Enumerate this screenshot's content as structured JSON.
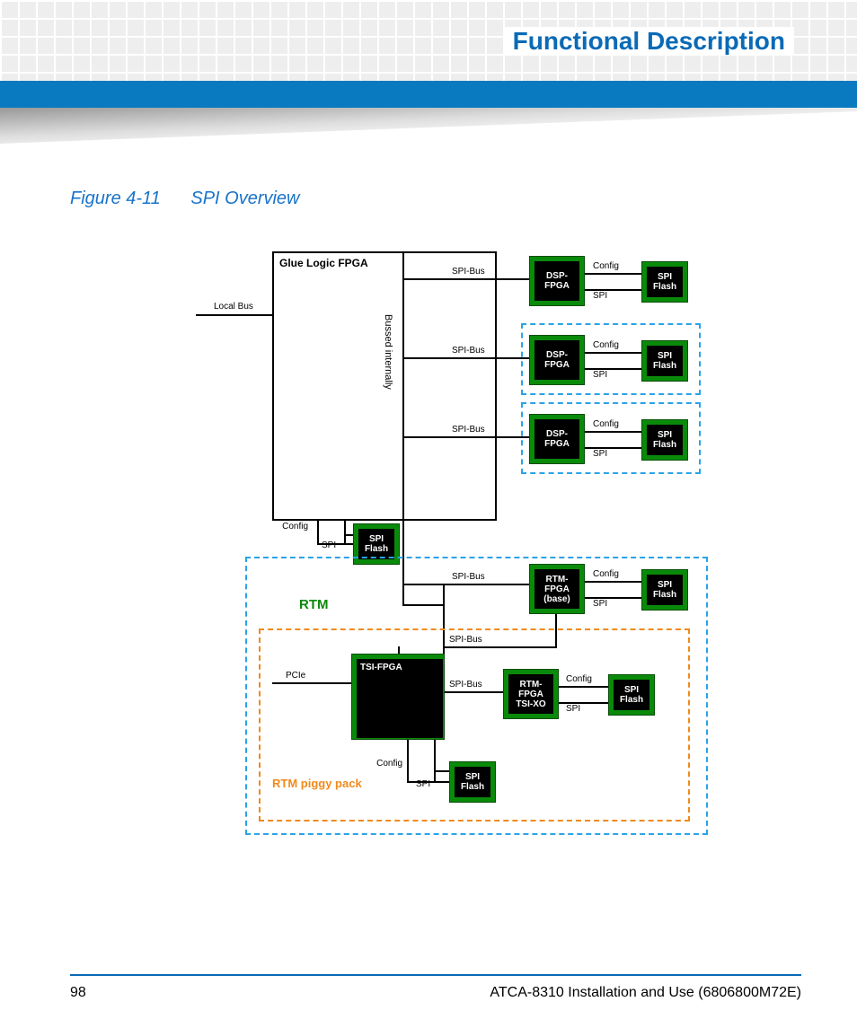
{
  "header": {
    "title": "Functional Description"
  },
  "figure": {
    "caption_num": "Figure 4-11",
    "caption_title": "SPI Overview",
    "glue_label": "Glue Logic FPGA",
    "bussed": "Bussed internally",
    "rtm": "RTM",
    "piggy": "RTM piggy pack",
    "labels": {
      "local_bus": "Local Bus",
      "spi_bus": "SPI-Bus",
      "config": "Config",
      "spi": "SPI",
      "pcie": "PCIe"
    },
    "chips": {
      "dsp_fpga": "DSP-\nFPGA",
      "spi_flash": "SPI\nFlash",
      "rtm_fpga_base": "RTM-\nFPGA\n(base)",
      "tsi_fpga": "TSI-FPGA",
      "rtm_fpga_tsi": "RTM-\nFPGA\nTSI-XO"
    }
  },
  "footer": {
    "page": "98",
    "doc": "ATCA-8310 Installation and Use (6806800M72E)"
  }
}
